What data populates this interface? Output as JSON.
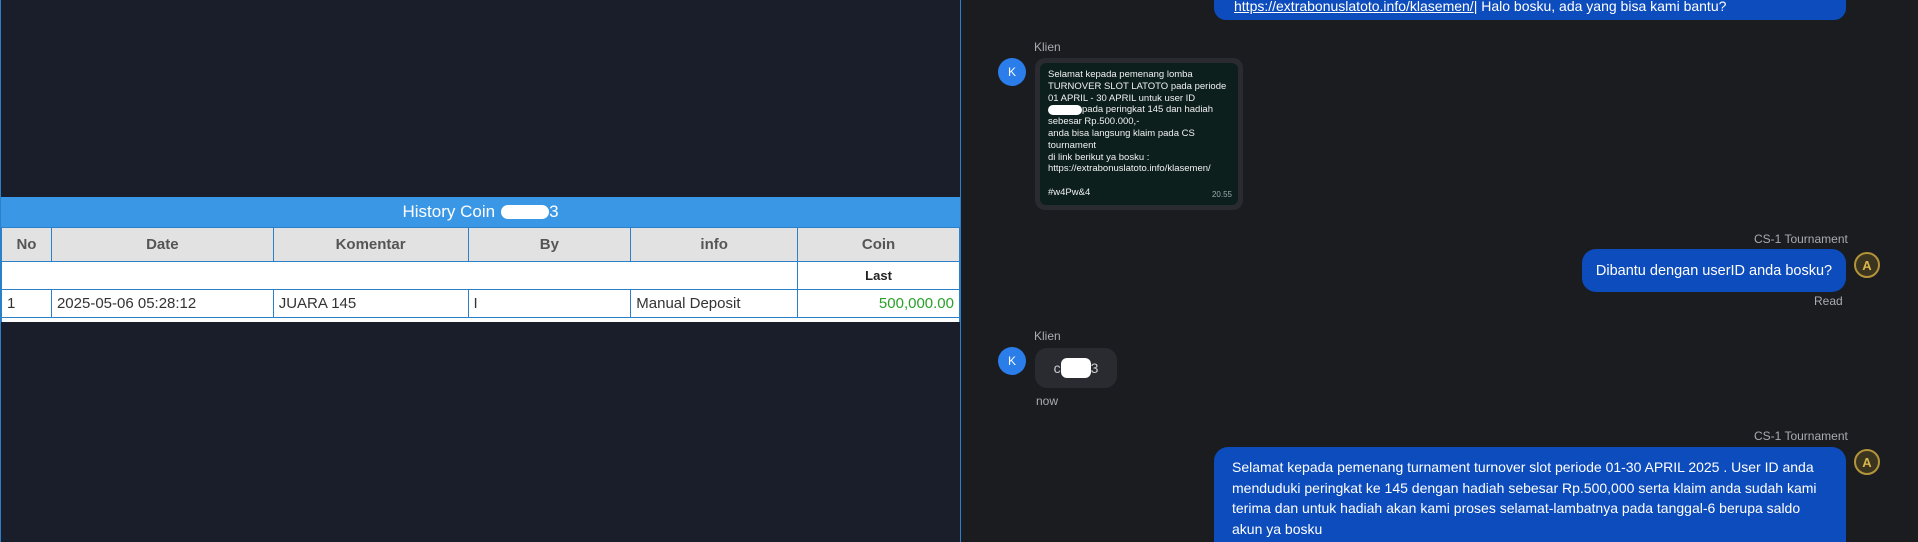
{
  "history": {
    "title_prefix": "History Coin",
    "title_suffix": "3",
    "columns": [
      "No",
      "Date",
      "Komentar",
      "By",
      "info",
      "Coin"
    ],
    "last_label": "Last",
    "rows": [
      {
        "no": "1",
        "date": "2025-05-06 05:28:12",
        "komentar": "JUARA 145",
        "by": "I",
        "info": "Manual Deposit",
        "coin": "500,000.00"
      }
    ]
  },
  "chat": {
    "top_bubble": {
      "link": "https://extrabonuslatoto.info/klasemen/",
      "text": " | Halo bosku, ada yang bisa kami bantu?"
    },
    "client_label": "Klien",
    "client_initial": "K",
    "agent_label": "CS-1 Tournament",
    "agent_icon": "A",
    "image_text": {
      "lines": [
        "Selamat kepada pemenang lomba",
        "TURNOVER SLOT LATOTO pada periode",
        "01 APRIL - 30 APRIL untuk user ID",
        "pada peringkat 145 dan hadiah",
        "sebesar Rp.500.000,-",
        "anda bisa langsung klaim pada CS",
        "tournament",
        "di link berikut ya bosku :",
        "https://extrabonuslatoto.info/klasemen/",
        "",
        "#w4Pw&4"
      ],
      "time": "20.55"
    },
    "msg_ask_userid": "Dibantu dengan userID anda bosku?",
    "read_label": "Read",
    "client_reply_prefix": "c",
    "client_reply_suffix": "3",
    "now_label": "now",
    "msg_final": "Selamat kepada pemenang turnament turnover slot periode 01-30 APRIL 2025 . User ID anda menduduki peringkat ke 145 dengan hadiah sebesar Rp.500,000 serta klaim anda sudah kami terima dan untuk hadiah akan kami proses selamat-lambatnya pada tanggal-6 berupa saldo akun ya bosku"
  },
  "colors": {
    "accent_blue": "#3a97e6",
    "bubble_blue": "#0d4cbc",
    "coin_green": "#2aa02a"
  }
}
